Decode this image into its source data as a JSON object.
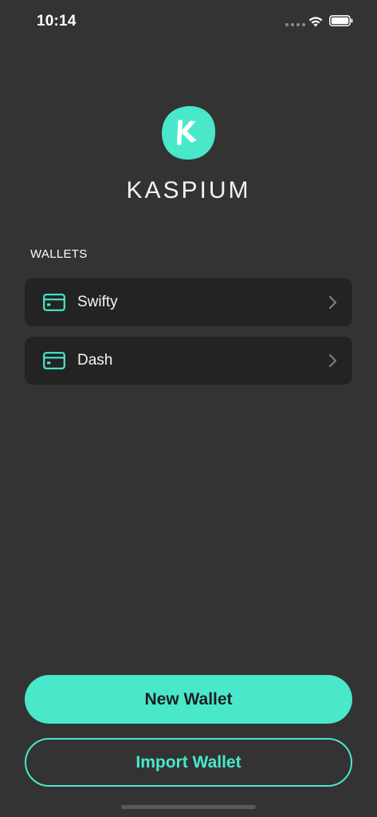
{
  "status_bar": {
    "time": "10:14"
  },
  "app": {
    "name": "KASPIUM",
    "logo_icon": "kaspa-logo-icon",
    "accent_color": "#49e8cb"
  },
  "wallets_section": {
    "title": "WALLETS",
    "items": [
      {
        "label": "Swifty",
        "icon": "wallet-card-icon"
      },
      {
        "label": "Dash",
        "icon": "wallet-card-icon"
      }
    ]
  },
  "actions": {
    "new_wallet_label": "New Wallet",
    "import_wallet_label": "Import Wallet"
  }
}
